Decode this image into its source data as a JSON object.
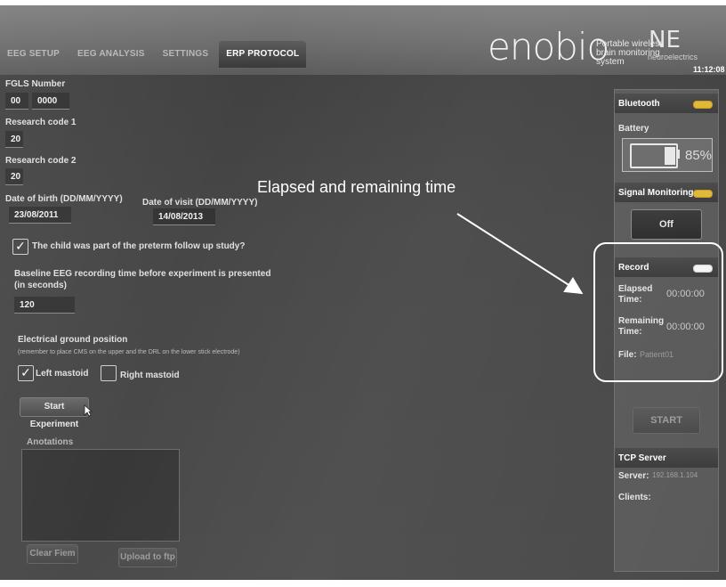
{
  "tabs": [
    "EEG SETUP",
    "EEG ANALYSIS",
    "SETTINGS",
    "ERP PROTOCOL"
  ],
  "active_tab": "ERP PROTOCOL",
  "brand": {
    "name": "enobio",
    "tagline_1": "Portable wireless",
    "tagline_2": "brain monitoring",
    "tagline_3": "system",
    "company_logo": "NE",
    "company": "neuroelectrics"
  },
  "clock": "11:12:08",
  "form": {
    "fgls_label": "FGLS Number",
    "fgls_value_1": "00",
    "fgls_value_2": "0000",
    "research_code_1_label": "Research code 1",
    "research_code_1_value": "20",
    "research_code_2_label": "Research code 2",
    "research_code_2_value": "20",
    "dob_label": "Date of birth (DD/MM/YYYY)",
    "dob_value": "23/08/2011",
    "dov_label": "Date of visit (DD/MM/YYYY)",
    "dov_value": "14/08/2013",
    "preterm_label": "The child was part of the preterm follow up study?",
    "preterm_checked": true,
    "baseline_label_1": "Baseline EEG recording time before experiment is presented",
    "baseline_label_2": "(in seconds)",
    "baseline_value": "120",
    "ground_label": "Electrical ground position",
    "ground_note": "(remember to place CMS on the upper and the DRL on the lower stick electrode)",
    "left_mastoid_label": "Left mastoid",
    "left_mastoid_checked": true,
    "right_mastoid_label": "Right mastoid",
    "right_mastoid_checked": false,
    "start_button": "Start Experiment",
    "annotations_label": "Anotations",
    "clear_button": "Clear Fiem",
    "upload_button": "Upload to ftp"
  },
  "sidebar": {
    "bluetooth_label": "Bluetooth",
    "battery_label": "Battery",
    "battery_percent": "85%",
    "battery_level": 0.85,
    "signal_label": "Signal Monitoring",
    "signal_button": "Off",
    "record_label": "Record",
    "elapsed_label_1": "Elapsed",
    "elapsed_label_2": "Time:",
    "elapsed_value": "00:00:00",
    "remaining_label_1": "Remaining",
    "remaining_label_2": "Time:",
    "remaining_value": "00:00:00",
    "file_label": "File:",
    "file_value": "Patient01",
    "start_button": "START",
    "tcp_label": "TCP Server",
    "server_label": "Server:",
    "server_value": "192.168.1.104",
    "clients_label": "Clients:"
  },
  "annotation_text": "Elapsed and remaining time",
  "colors": {
    "status_pill": "#e1b735",
    "background": "#474747"
  }
}
